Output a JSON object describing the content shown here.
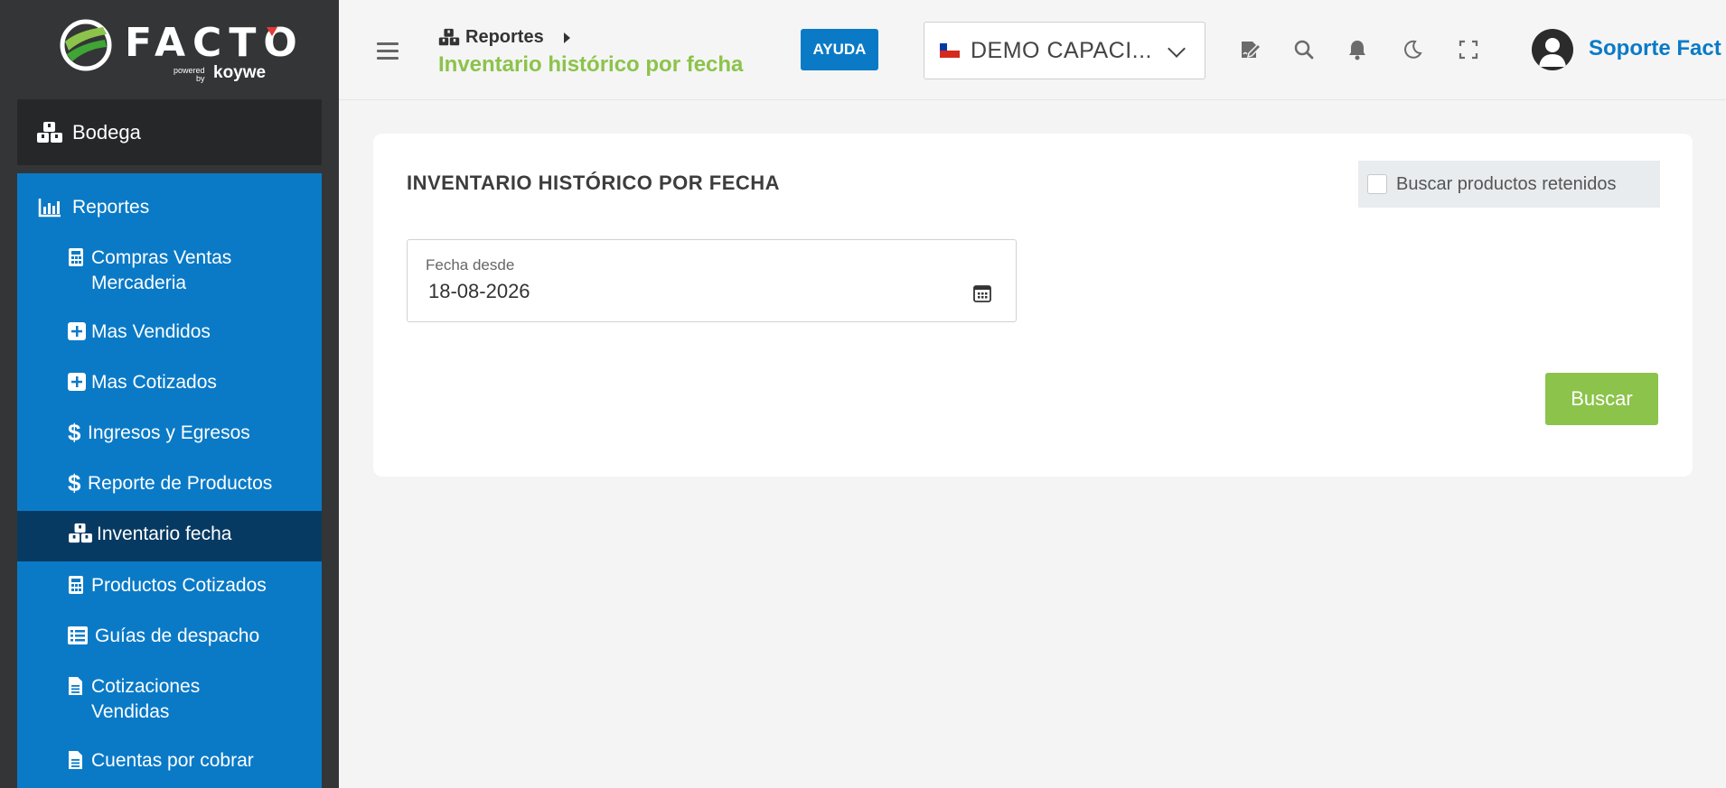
{
  "brand": {
    "name": "FACTO",
    "powered": "powered",
    "by": "by",
    "koywe": "koywe"
  },
  "sidebar": {
    "top": {
      "label": "Bodega",
      "icon": "boxes-icon"
    },
    "section": {
      "label": "Reportes",
      "icon": "bar-chart-icon"
    },
    "items": [
      {
        "label": "Compras Ventas Mercaderia",
        "icon": "calculator-icon"
      },
      {
        "label": "Mas Vendidos",
        "icon": "plus-square-icon"
      },
      {
        "label": "Mas Cotizados",
        "icon": "plus-square-icon"
      },
      {
        "label": "Ingresos y Egresos",
        "icon": "dollar-icon"
      },
      {
        "label": "Reporte de Productos",
        "icon": "dollar-icon"
      },
      {
        "label": "Inventario fecha",
        "icon": "boxes-icon",
        "active": true
      },
      {
        "label": "Productos Cotizados",
        "icon": "calculator-icon"
      },
      {
        "label": "Guías de despacho",
        "icon": "list-icon"
      },
      {
        "label": "Cotizaciones Vendidas",
        "icon": "document-icon"
      },
      {
        "label": "Cuentas por cobrar",
        "icon": "document-icon"
      }
    ]
  },
  "header": {
    "breadcrumb": "Reportes",
    "page_title": "Inventario histórico por fecha",
    "help_button": "AYUDA",
    "company": "DEMO CAPACI...",
    "user": "Soporte Fact"
  },
  "main": {
    "title": "INVENTARIO HISTÓRICO POR FECHA",
    "retained_checkbox_label": "Buscar productos retenidos",
    "date_label": "Fecha desde",
    "date_value": "18-08-2026",
    "search_button": "Buscar"
  },
  "colors": {
    "sidebar_bg": "#333537",
    "menu_bg": "#0a7ac7",
    "menu_active": "#073a62",
    "accent_green": "#8cc34b",
    "accent_blue": "#0a7ac7"
  }
}
